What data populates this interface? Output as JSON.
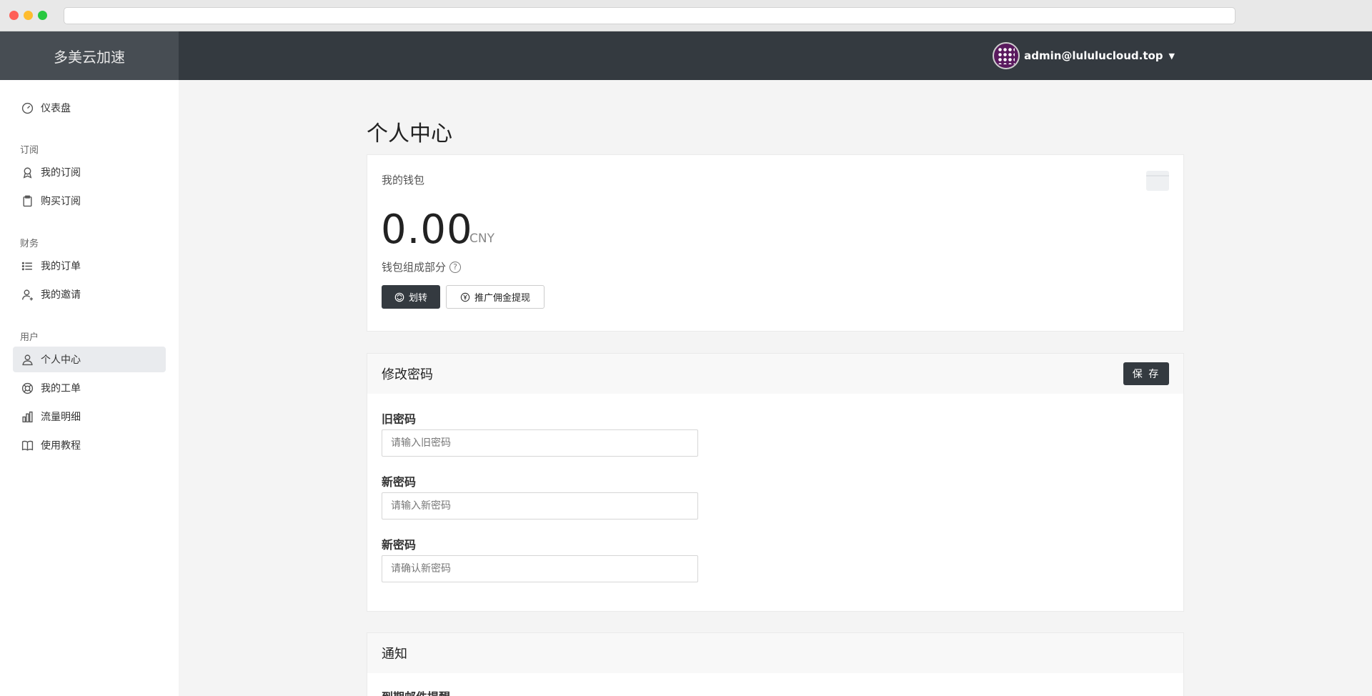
{
  "brand": "多美云加速",
  "user": {
    "email": "admin@lulul​ucloud.top"
  },
  "sidebar": {
    "dashboard": "仪表盘",
    "section_subscribe": "订阅",
    "my_subscription": "我的订阅",
    "buy_subscription": "购买订阅",
    "section_finance": "财务",
    "my_orders": "我的订单",
    "my_invites": "我的邀请",
    "section_user": "用户",
    "profile": "个人中心",
    "my_tickets": "我的工单",
    "traffic_detail": "流量明细",
    "tutorial": "使用教程"
  },
  "page": {
    "title": "个人中心"
  },
  "wallet": {
    "label": "我的钱包",
    "amount": "0.00",
    "currency": "CNY",
    "composition": "钱包组成部分",
    "transfer_button": "划转",
    "withdraw_button": "推广佣金提现"
  },
  "password": {
    "title": "修改密码",
    "save_button": "保 存",
    "old_label": "旧密码",
    "old_placeholder": "请输入旧密码",
    "new_label": "新密码",
    "new_placeholder": "请输入新密码",
    "confirm_label": "新密码",
    "confirm_placeholder": "请确认新密码"
  },
  "notify": {
    "title": "通知",
    "first_label": "到期邮件提醒"
  }
}
